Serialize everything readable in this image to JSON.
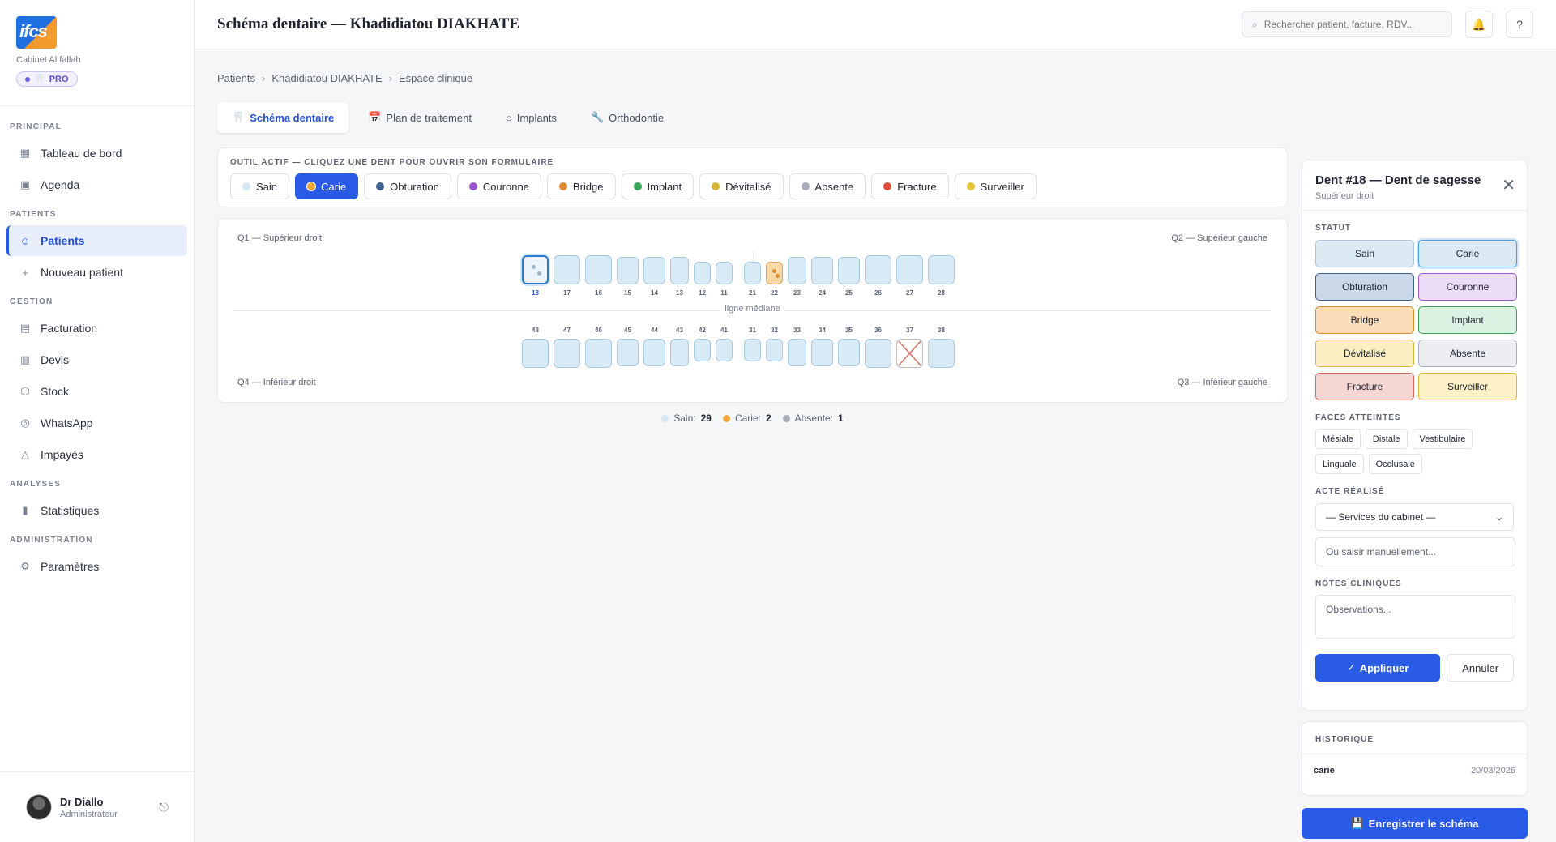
{
  "sidebar": {
    "cabinet": "Cabinet Al fallah",
    "pro_label": "PRO",
    "sections": [
      {
        "label": "PRINCIPAL",
        "items": [
          {
            "label": "Tableau de bord",
            "icon": "grid-icon"
          },
          {
            "label": "Agenda",
            "icon": "calendar-icon"
          }
        ]
      },
      {
        "label": "PATIENTS",
        "items": [
          {
            "label": "Patients",
            "icon": "users-icon",
            "active": true
          },
          {
            "label": "Nouveau patient",
            "icon": "plus-icon"
          }
        ]
      },
      {
        "label": "GESTION",
        "items": [
          {
            "label": "Facturation",
            "icon": "invoice-icon"
          },
          {
            "label": "Devis",
            "icon": "clipboard-icon"
          },
          {
            "label": "Stock",
            "icon": "box-icon"
          },
          {
            "label": "WhatsApp",
            "icon": "whatsapp-icon"
          },
          {
            "label": "Impayés",
            "icon": "warning-icon"
          }
        ]
      },
      {
        "label": "ANALYSES",
        "items": [
          {
            "label": "Statistiques",
            "icon": "bar-chart-icon"
          }
        ]
      },
      {
        "label": "ADMINISTRATION",
        "items": [
          {
            "label": "Paramètres",
            "icon": "gear-icon"
          }
        ]
      }
    ],
    "user": {
      "name": "Dr Diallo",
      "role": "Administrateur"
    }
  },
  "header": {
    "title": "Schéma dentaire — Khadidiatou DIAKHATE",
    "search_placeholder": "Rechercher patient, facture, RDV..."
  },
  "breadcrumb": [
    "Patients",
    "Khadidiatou DIAKHATE",
    "Espace clinique"
  ],
  "tabs": [
    {
      "label": "Schéma dentaire",
      "icon": "🦷",
      "active": true
    },
    {
      "label": "Plan de traitement",
      "icon": "📅"
    },
    {
      "label": "Implants",
      "icon": "○"
    },
    {
      "label": "Orthodontie",
      "icon": "🔧"
    }
  ],
  "tools": {
    "title": "OUTIL ACTIF — CLIQUEZ UNE DENT POUR OUVRIR SON FORMULAIRE",
    "items": [
      {
        "label": "Sain",
        "color": "#d6e8f5"
      },
      {
        "label": "Carie",
        "color": "#f0a53c",
        "active": true
      },
      {
        "label": "Obturation",
        "color": "#3f5f8f"
      },
      {
        "label": "Couronne",
        "color": "#9a55d6"
      },
      {
        "label": "Bridge",
        "color": "#e08a2e"
      },
      {
        "label": "Implant",
        "color": "#3aa55b"
      },
      {
        "label": "Dévitalisé",
        "color": "#d9b53a"
      },
      {
        "label": "Absente",
        "color": "#a7adb8"
      },
      {
        "label": "Fracture",
        "color": "#e04b3a"
      },
      {
        "label": "Surveiller",
        "color": "#e8c53a"
      }
    ]
  },
  "chart": {
    "q1": "Q1 — Supérieur droit",
    "q2": "Q2 — Supérieur gauche",
    "q3": "Q3 — Inférieur gauche",
    "q4": "Q4 — Inférieur droit",
    "midline": "ligne médiane",
    "upper": [
      {
        "n": "18",
        "state": "selected"
      },
      {
        "n": "17"
      },
      {
        "n": "16"
      },
      {
        "n": "15"
      },
      {
        "n": "14"
      },
      {
        "n": "13"
      },
      {
        "n": "12"
      },
      {
        "n": "11"
      },
      {
        "n": "21"
      },
      {
        "n": "22",
        "state": "carie"
      },
      {
        "n": "23"
      },
      {
        "n": "24"
      },
      {
        "n": "25"
      },
      {
        "n": "26"
      },
      {
        "n": "27"
      },
      {
        "n": "28"
      }
    ],
    "lower": [
      {
        "n": "48"
      },
      {
        "n": "47"
      },
      {
        "n": "46"
      },
      {
        "n": "45"
      },
      {
        "n": "44"
      },
      {
        "n": "43"
      },
      {
        "n": "42"
      },
      {
        "n": "41"
      },
      {
        "n": "31"
      },
      {
        "n": "32"
      },
      {
        "n": "33"
      },
      {
        "n": "34"
      },
      {
        "n": "35"
      },
      {
        "n": "36"
      },
      {
        "n": "37",
        "state": "absent"
      },
      {
        "n": "38"
      }
    ]
  },
  "legend": [
    {
      "label": "Sain:",
      "count": "29",
      "color": "#d6e8f5"
    },
    {
      "label": "Carie:",
      "count": "2",
      "color": "#f0a53c"
    },
    {
      "label": "Absente:",
      "count": "1",
      "color": "#a7adb8"
    }
  ],
  "panel": {
    "title": "Dent #18 — Dent de sagesse",
    "subtitle": "Supérieur droit",
    "statut_label": "STATUT",
    "statuses": [
      {
        "label": "Sain",
        "bg": "#dceaf4",
        "border": "#a9c6dc"
      },
      {
        "label": "Carie",
        "bg": "#dceaf4",
        "border": "#4b9be0",
        "selected": true
      },
      {
        "label": "Obturation",
        "bg": "#c9d7e8",
        "border": "#3f5f8f"
      },
      {
        "label": "Couronne",
        "bg": "#ecdcf7",
        "border": "#9a55d6"
      },
      {
        "label": "Bridge",
        "bg": "#fadcb8",
        "border": "#e08a2e"
      },
      {
        "label": "Implant",
        "bg": "#dcf1e2",
        "border": "#3aa55b"
      },
      {
        "label": "Dévitalisé",
        "bg": "#fbeec2",
        "border": "#d9b53a"
      },
      {
        "label": "Absente",
        "bg": "#eceef1",
        "border": "#a7adb8"
      },
      {
        "label": "Fracture",
        "bg": "#f5d6d2",
        "border": "#d9695b"
      },
      {
        "label": "Surveiller",
        "bg": "#fbf0c6",
        "border": "#d9b53a"
      }
    ],
    "faces_label": "FACES ATTEINTES",
    "faces": [
      "Mésiale",
      "Distale",
      "Vestibulaire",
      "Linguale",
      "Occlusale"
    ],
    "acte_label": "ACTE RÉALISÉ",
    "acte_select": "— Services du cabinet —",
    "acte_placeholder": "Ou saisir manuellement...",
    "notes_label": "NOTES CLINIQUES",
    "notes_placeholder": "Observations...",
    "apply_label": "Appliquer",
    "cancel_label": "Annuler"
  },
  "history": {
    "title": "HISTORIQUE",
    "rows": [
      {
        "act": "carie",
        "date": "20/03/2026"
      }
    ]
  },
  "save_label": "Enregistrer le schéma"
}
